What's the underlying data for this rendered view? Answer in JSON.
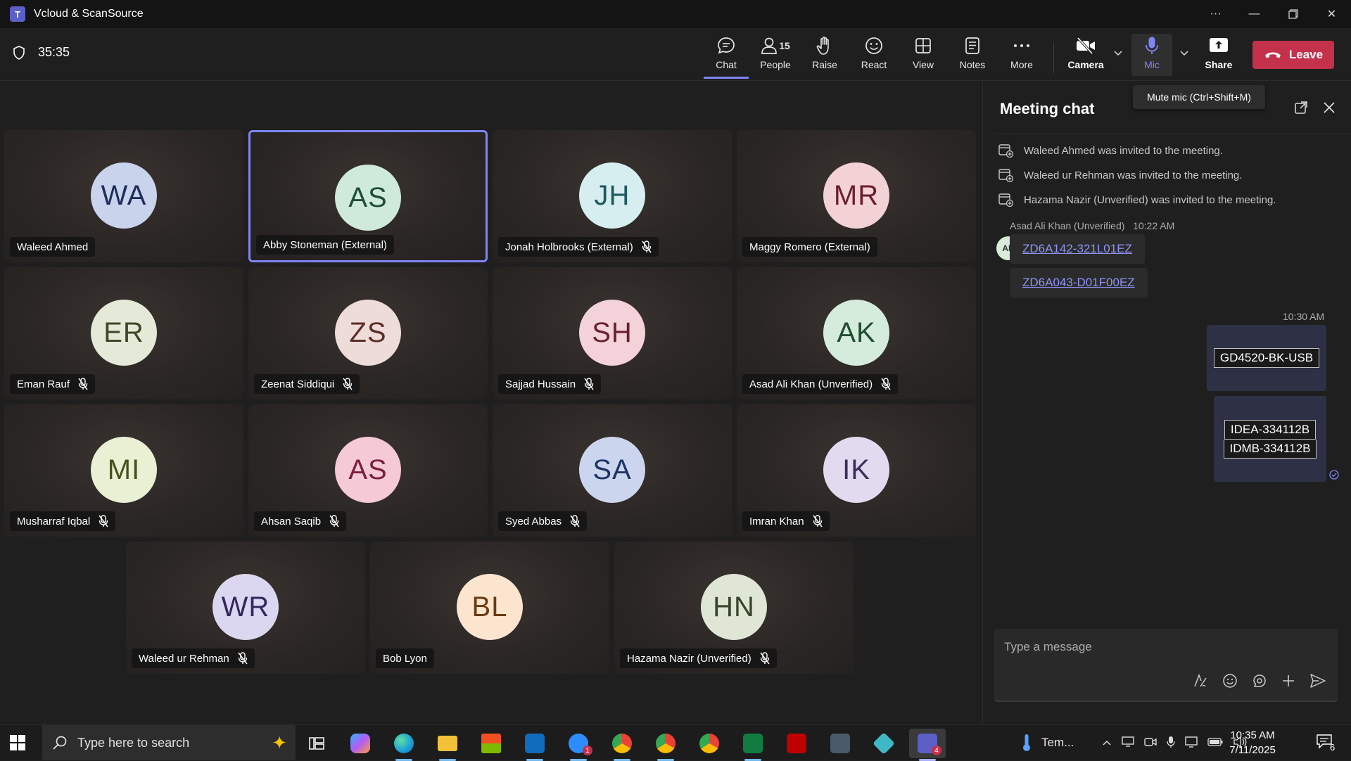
{
  "window": {
    "title": "Vcloud & ScanSource",
    "app_icon_letter": "T"
  },
  "toolbar": {
    "timer": "35:35",
    "buttons": {
      "chat": "Chat",
      "people": "People",
      "people_count": "15",
      "raise": "Raise",
      "react": "React",
      "view": "View",
      "notes": "Notes",
      "more": "More",
      "camera": "Camera",
      "mic": "Mic",
      "share": "Share"
    },
    "leave_label": "Leave",
    "mic_tooltip": "Mute mic (Ctrl+Shift+M)"
  },
  "participants": [
    {
      "initials": "WA",
      "name": "Waleed Ahmed",
      "muted": false,
      "speaking": false,
      "avatar_bg": "#c9d3ec",
      "avatar_fg": "#1e2f5c"
    },
    {
      "initials": "AS",
      "name": "Abby Stoneman (External)",
      "muted": false,
      "speaking": true,
      "avatar_bg": "#cfeadb",
      "avatar_fg": "#1e4f36"
    },
    {
      "initials": "JH",
      "name": "Jonah Holbrooks (External)",
      "muted": true,
      "speaking": false,
      "avatar_bg": "#d7eef0",
      "avatar_fg": "#1f5960"
    },
    {
      "initials": "MR",
      "name": "Maggy Romero (External)",
      "muted": false,
      "speaking": false,
      "avatar_bg": "#f3d2d6",
      "avatar_fg": "#6b1f2a"
    },
    {
      "initials": "ER",
      "name": "Eman Rauf",
      "muted": true,
      "speaking": false,
      "avatar_bg": "#e5e9d8",
      "avatar_fg": "#3d4727"
    },
    {
      "initials": "ZS",
      "name": "Zeenat Siddiqui",
      "muted": true,
      "speaking": false,
      "avatar_bg": "#eedcd9",
      "avatar_fg": "#5a2e27"
    },
    {
      "initials": "SH",
      "name": "Sajjad Hussain",
      "muted": true,
      "speaking": false,
      "avatar_bg": "#f3d3d9",
      "avatar_fg": "#6b1f2e"
    },
    {
      "initials": "AK",
      "name": "Asad Ali Khan (Unverified)",
      "muted": true,
      "speaking": false,
      "avatar_bg": "#d5ecdc",
      "avatar_fg": "#204d30"
    },
    {
      "initials": "MI",
      "name": "Musharraf Iqbal",
      "muted": true,
      "speaking": false,
      "avatar_bg": "#e9f0d4",
      "avatar_fg": "#45511f"
    },
    {
      "initials": "AS",
      "name": "Ahsan Saqib",
      "muted": true,
      "speaking": false,
      "avatar_bg": "#f5c9d6",
      "avatar_fg": "#7a1f3d"
    },
    {
      "initials": "SA",
      "name": "Syed Abbas",
      "muted": true,
      "speaking": false,
      "avatar_bg": "#cbd6ee",
      "avatar_fg": "#1f3466"
    },
    {
      "initials": "IK",
      "name": "Imran Khan",
      "muted": true,
      "speaking": false,
      "avatar_bg": "#e2dbef",
      "avatar_fg": "#3b2d5e"
    },
    {
      "initials": "WR",
      "name": "Waleed ur Rehman",
      "muted": true,
      "speaking": false,
      "avatar_bg": "#dcd7f0",
      "avatar_fg": "#33285e"
    },
    {
      "initials": "BL",
      "name": "Bob Lyon",
      "muted": false,
      "speaking": false,
      "avatar_bg": "#fbe5cf",
      "avatar_fg": "#6b3b12"
    },
    {
      "initials": "HN",
      "name": "Hazama Nazir (Unverified)",
      "muted": true,
      "speaking": false,
      "avatar_bg": "#dfe6d6",
      "avatar_fg": "#37452a"
    }
  ],
  "chat": {
    "title": "Meeting chat",
    "system_messages": [
      "Waleed Ahmed was invited to the meeting.",
      "Waleed ur Rehman was invited to the meeting.",
      "Hazama Nazir (Unverified) was invited to the meeting."
    ],
    "incoming": {
      "sender": "Asad Ali Khan (Unverified)",
      "time": "10:22 AM",
      "avatar_initials": "AK",
      "links": [
        "ZD6A142-321L01EZ",
        "ZD6A043-D01F00EZ"
      ]
    },
    "outgoing": {
      "time": "10:30 AM",
      "messages": [
        [
          "GD4520-BK-USB"
        ],
        [
          "IDEA-334112B",
          "IDMB-334112B"
        ]
      ]
    },
    "compose_placeholder": "Type a message"
  },
  "taskbar": {
    "search_placeholder": "Type here to search",
    "weather_label": "Tem...",
    "time": "10:35 AM",
    "date": "7/11/2025",
    "notification_count": "6",
    "outlook_badge": "1",
    "teams_badge": "4"
  }
}
